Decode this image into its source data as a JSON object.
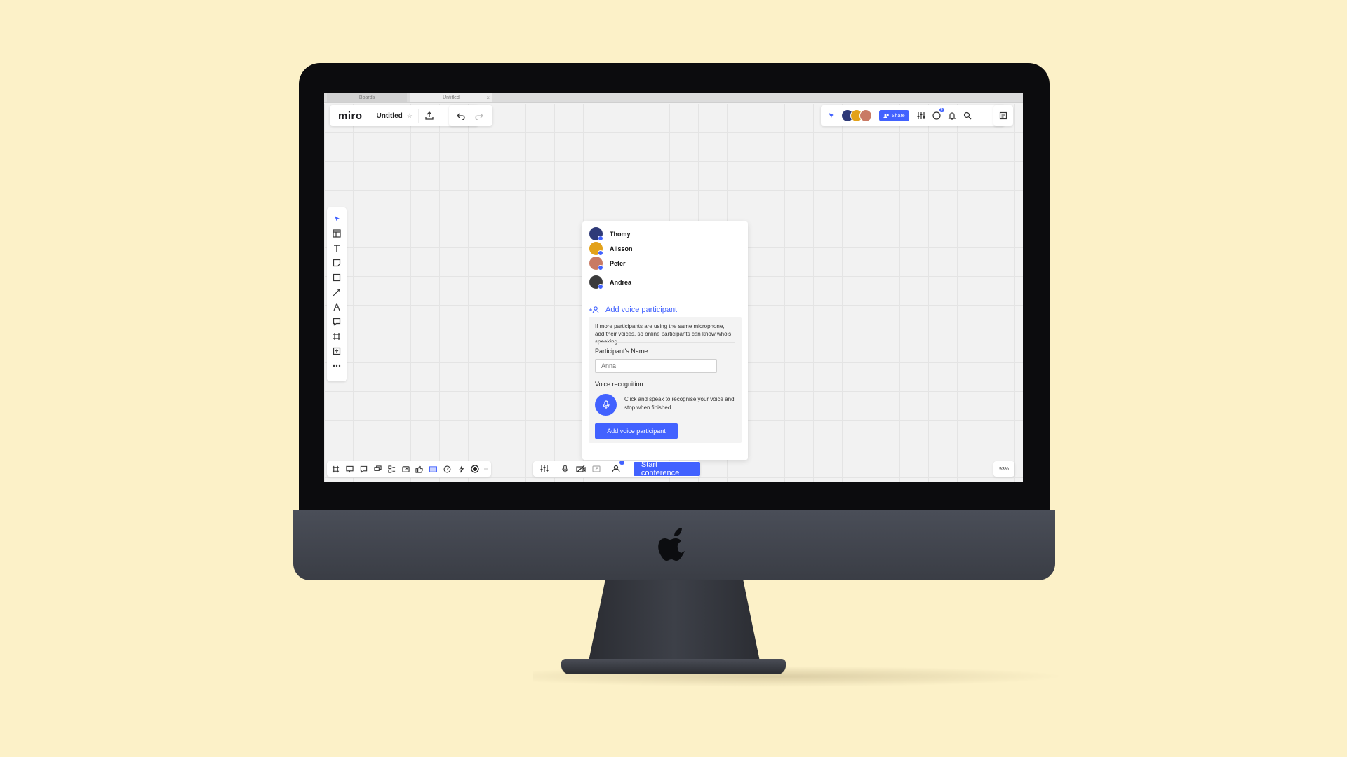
{
  "tabs": [
    {
      "label": "Boards"
    },
    {
      "label": "Untitled"
    }
  ],
  "app": {
    "logo": "miro",
    "board_name": "Untitled"
  },
  "header": {
    "share_label": "Share",
    "notifications_count": "4"
  },
  "participants": [
    {
      "name": "Thomy",
      "avatar_color": "#2f3a78"
    },
    {
      "name": "Alisson",
      "avatar_color": "#e3a21a"
    },
    {
      "name": "Peter",
      "avatar_color": "#c97a64"
    },
    {
      "name": "Andrea",
      "avatar_color": "#3b3b3b"
    }
  ],
  "voice_dialog": {
    "add_link": "Add voice participant",
    "help_text": "If more participants are using the same microphone, add their voices, so online participants can know who's speaking.",
    "name_label": "Participant's Name:",
    "name_placeholder": "Anna",
    "voice_label": "Voice recognition:",
    "mic_instruction": "Click and speak to recognise your voice and stop when finished",
    "add_button": "Add voice participant"
  },
  "bottom": {
    "start_conference": "Start conference",
    "participants_badge": "1",
    "zoom": "93%"
  },
  "colors": {
    "accent": "#4262ff",
    "background": "#fcf1c8",
    "canvas": "#f2f2f2"
  }
}
